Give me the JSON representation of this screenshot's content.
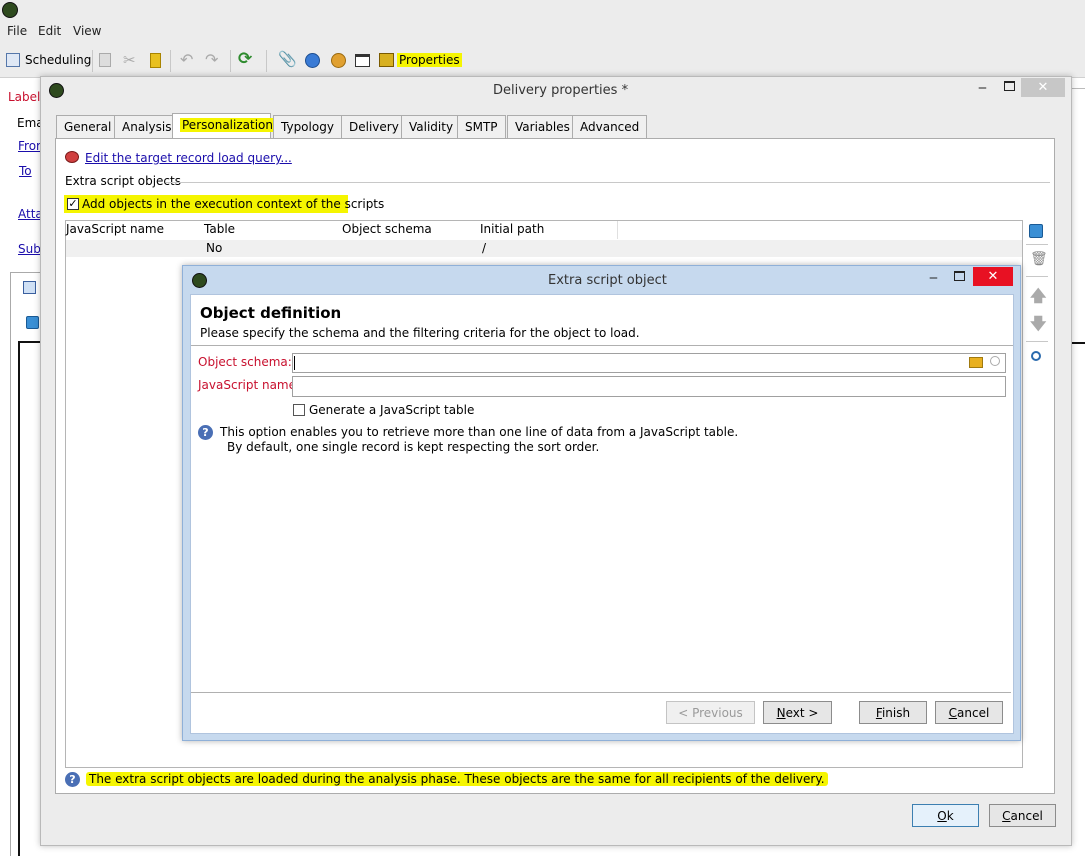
{
  "menubar": {
    "file": "File",
    "edit": "Edit",
    "view": "View"
  },
  "toolbar": {
    "scheduling": "Scheduling",
    "properties": "Properties"
  },
  "left_form": {
    "label": "Label:",
    "email": "Ema",
    "from": "Fror",
    "to": "To",
    "attachments": "Atta",
    "subject": "Sub"
  },
  "delivery_dialog": {
    "title": "Delivery properties *",
    "tabs": [
      "General",
      "Analysis",
      "Personalization",
      "Typology",
      "Delivery",
      "Validity",
      "SMTP",
      "Variables",
      "Advanced"
    ],
    "active_tab": "Personalization",
    "edit_query_link": "Edit the target record load query...",
    "section_title": "Extra script objects",
    "checkbox_label": "Add objects in the execution context of the scripts",
    "checkbox_checked": true,
    "table": {
      "columns": [
        "JavaScript name",
        "Table",
        "Object schema",
        "Initial path"
      ],
      "rows": [
        [
          "",
          "No",
          "",
          "/"
        ]
      ]
    },
    "info_text": "The extra script objects are loaded during the analysis phase. These objects are the same for all recipients of the delivery.",
    "ok_label": "Ok",
    "cancel_label": "Cancel"
  },
  "extra_script_dialog": {
    "title": "Extra script object",
    "heading": "Object definition",
    "subheading": "Please specify the schema and the filtering criteria for the object to load.",
    "object_schema_label": "Object schema:",
    "object_schema_value": "",
    "javascript_name_label": "JavaScript name:",
    "javascript_name_value": "",
    "generate_table_label": "Generate a JavaScript table",
    "generate_table_checked": false,
    "info_line1": "This option enables you to retrieve more than one line of data from a JavaScript table.",
    "info_line2": "By default, one single record is kept respecting the sort order.",
    "previous_label": "< Previous",
    "next_label": "Next >",
    "finish_label": "Finish",
    "cancel_label": "Cancel"
  },
  "colors": {
    "highlight": "#f5f500",
    "required_label": "#c8102e",
    "close_button": "#e81123"
  }
}
